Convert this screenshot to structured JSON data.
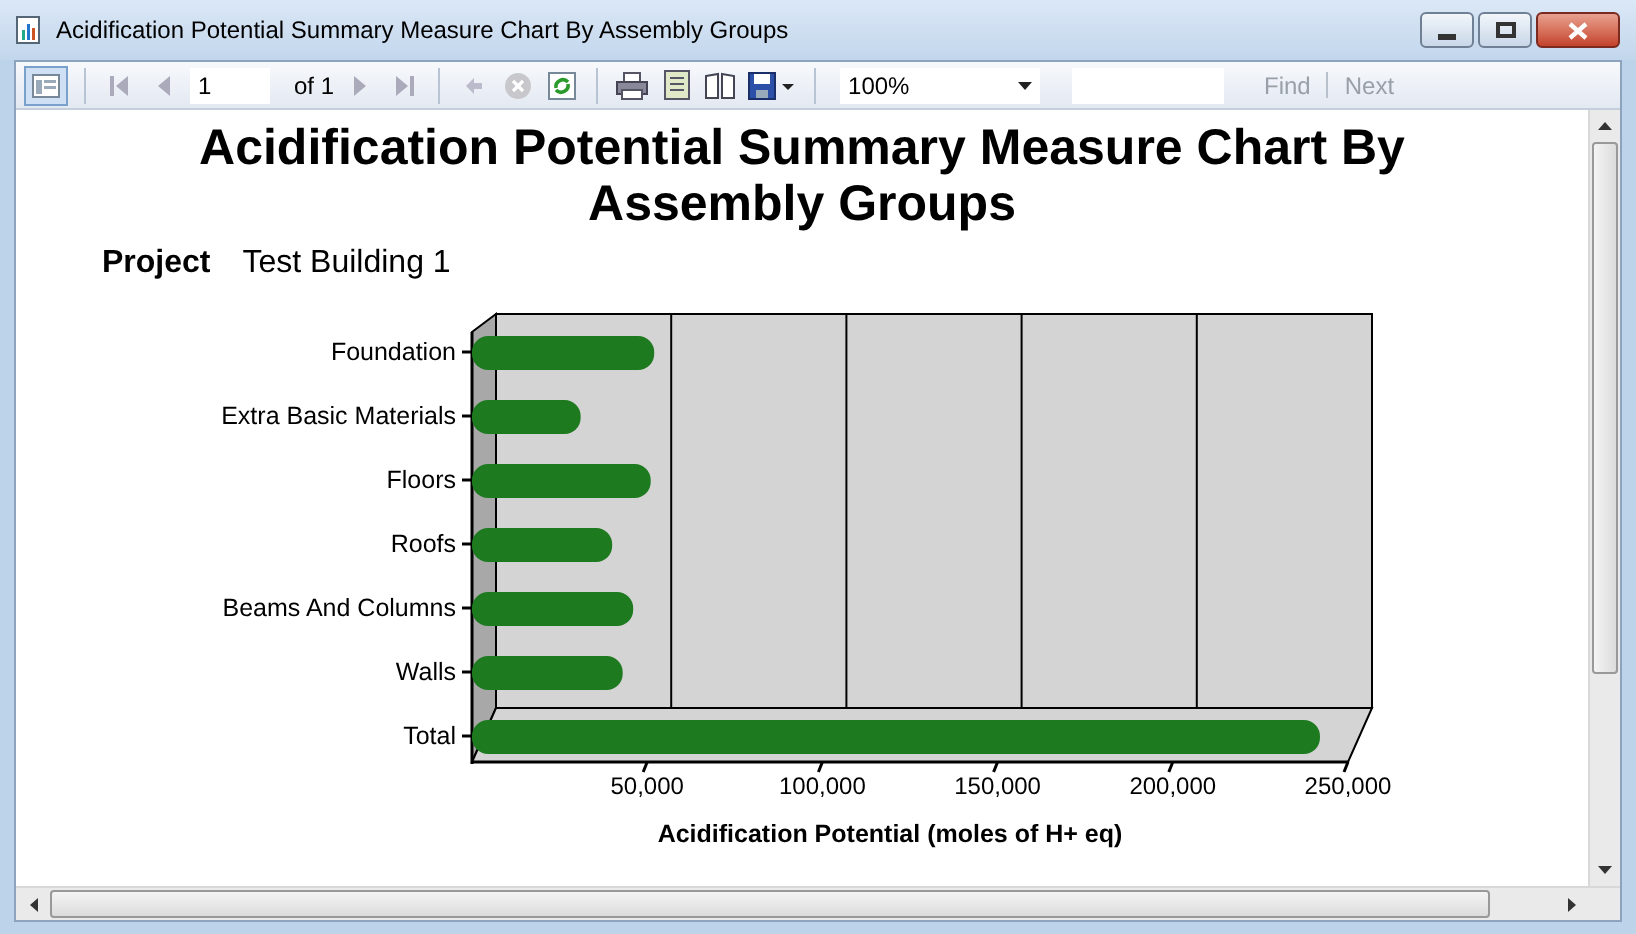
{
  "window": {
    "title": "Acidification Potential Summary Measure Chart By Assembly Groups"
  },
  "toolbar": {
    "page": "1",
    "of_label": "of 1",
    "zoom": "100%",
    "find": "Find",
    "next": "Next"
  },
  "report": {
    "title": "Acidification Potential Summary Measure Chart By Assembly Groups",
    "project_label": "Project",
    "project_value": "Test Building 1",
    "chart_data": {
      "type": "bar",
      "orientation": "horizontal",
      "xlabel": "Acidification Potential (moles of H+ eq)",
      "categories": [
        "Foundation",
        "Extra Basic Materials",
        "Floors",
        "Roofs",
        "Beams And Columns",
        "Walls",
        "Total"
      ],
      "series": [
        {
          "color": "#1e7a1e",
          "values": [
            52000,
            31000,
            51000,
            40000,
            46000,
            43000,
            242000
          ]
        }
      ],
      "xlim": [
        0,
        250000
      ],
      "xticks": [
        {
          "value": 50000,
          "label": "50,000"
        },
        {
          "value": 100000,
          "label": "100,000"
        },
        {
          "value": 150000,
          "label": "150,000"
        },
        {
          "value": 200000,
          "label": "200,000"
        },
        {
          "value": 250000,
          "label": "250,000"
        }
      ]
    }
  }
}
